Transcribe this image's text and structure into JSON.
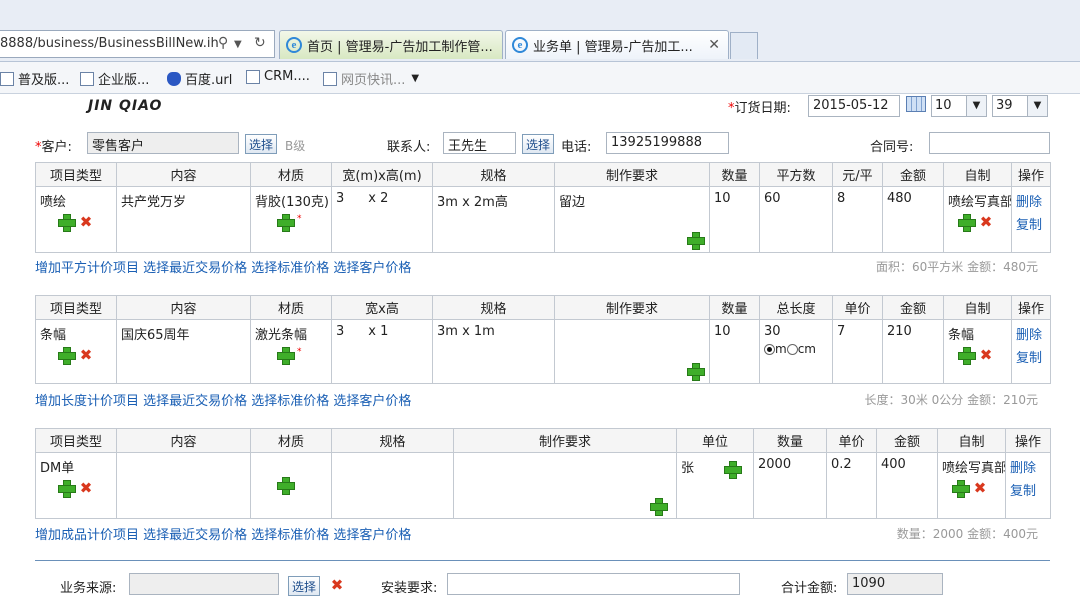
{
  "browser": {
    "address": "8888/business/BusinessBillNew.ih",
    "tabs": [
      {
        "label": "首页 | 管理易-广告加工制作管..."
      },
      {
        "label": "业务单 | 管理易-广告加工..."
      }
    ],
    "favorites": [
      {
        "label": "普及版..."
      },
      {
        "label": "企业版..."
      },
      {
        "label": "百度.url"
      },
      {
        "label": "CRM...."
      },
      {
        "label": "网页快讯..."
      }
    ]
  },
  "header": {
    "logo": "JIN QIAO",
    "order_date_label": "订货日期:",
    "order_date": "2015-05-12",
    "hour": "10",
    "minute": "39",
    "customer_label": "客户:",
    "customer": "零售客户",
    "select_label": "选择",
    "level": "B级",
    "contact_label": "联系人:",
    "contact": "王先生",
    "phone_label": "电话:",
    "phone": "13925199888",
    "contract_label": "合同号:",
    "contract": ""
  },
  "common": {
    "delete": "删除",
    "copy": "复制"
  },
  "area_table": {
    "headers": [
      "项目类型",
      "内容",
      "材质",
      "宽(m)x高(m)",
      "规格",
      "制作要求",
      "数量",
      "平方数",
      "元/平",
      "金额",
      "自制",
      "操作"
    ],
    "row": {
      "type": "喷绘",
      "content": "共产党万岁",
      "material": "背胶(130克)",
      "width": "3",
      "height": "x 2",
      "spec": "3m x 2m高",
      "requirement": "留边",
      "qty": "10",
      "area": "60",
      "unit_price": "8",
      "amount": "480",
      "self_made": "喷绘写真部"
    },
    "links": "增加平方计价项目 选择最近交易价格 选择标准价格 选择客户价格",
    "summary": "面积：60平方米  金额：480元"
  },
  "length_table": {
    "headers": [
      "项目类型",
      "内容",
      "材质",
      "宽x高",
      "规格",
      "制作要求",
      "数量",
      "总长度",
      "单价",
      "金额",
      "自制",
      "操作"
    ],
    "row": {
      "type": "条幅",
      "content": "国庆65周年",
      "material": "激光条幅",
      "width": "3",
      "height": "x 1",
      "spec": "3m x 1m",
      "requirement": "",
      "qty": "10",
      "total_length": "30",
      "unit_m": "m",
      "unit_cm": "cm",
      "unit_price": "7",
      "amount": "210",
      "self_made": "条幅"
    },
    "links": "增加长度计价项目 选择最近交易价格 选择标准价格 选择客户价格",
    "summary": "长度：30米 0公分  金额：210元"
  },
  "product_table": {
    "headers": [
      "项目类型",
      "内容",
      "材质",
      "规格",
      "制作要求",
      "单位",
      "数量",
      "单价",
      "金额",
      "自制",
      "操作"
    ],
    "row": {
      "type": "DM单",
      "content": "",
      "material": "",
      "spec": "",
      "requirement": "",
      "unit": "张",
      "qty": "2000",
      "unit_price": "0.2",
      "amount": "400",
      "self_made": "喷绘写真部"
    },
    "links": "增加成品计价项目 选择最近交易价格 选择标准价格 选择客户价格",
    "summary": "数量：2000  金额：400元"
  },
  "footer": {
    "source_label": "业务来源:",
    "source": "",
    "select_label": "选择",
    "install_label": "安装要求:",
    "install": "",
    "total_label": "合计金额:",
    "total": "1090"
  }
}
